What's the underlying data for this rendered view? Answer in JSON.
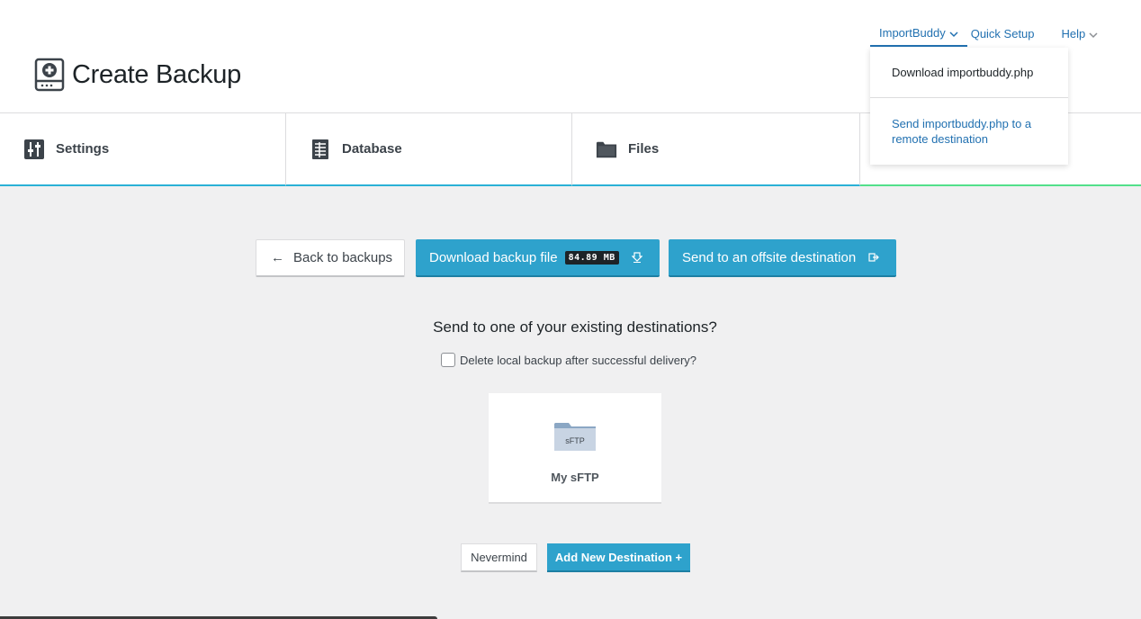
{
  "header": {
    "title": "Create Backup",
    "title_icon": "backup-drive-icon"
  },
  "topnav": {
    "importbuddy": "ImportBuddy",
    "quick_setup": "Quick Setup",
    "help": "Help"
  },
  "dropdown": {
    "items": [
      {
        "label": "Download importbuddy.php"
      },
      {
        "label": "Send importbuddy.php to a remote destination"
      }
    ]
  },
  "tabs": [
    {
      "label": "Settings",
      "icon": "settings-sliders-icon"
    },
    {
      "label": "Database",
      "icon": "database-doc-icon"
    },
    {
      "label": "Files",
      "icon": "folder-icon"
    }
  ],
  "actions": {
    "back": "Back to backups",
    "download": "Download backup file",
    "download_size": "84.89 MB",
    "send": "Send to an offsite destination"
  },
  "destinations": {
    "question": "Send to one of your existing destinations?",
    "delete_label": "Delete local backup after successful delivery?",
    "delete_checked": false,
    "items": [
      {
        "label": "My sFTP",
        "icon_text": "sFTP",
        "icon": "sftp-folder-icon"
      }
    ],
    "nevermind": "Nevermind",
    "add_new": "Add New Destination +"
  },
  "colors": {
    "accent": "#2ea2cc",
    "link": "#2271b1",
    "tab_underline": "#2ab1d6",
    "tab_underline_active": "#52e08a"
  }
}
